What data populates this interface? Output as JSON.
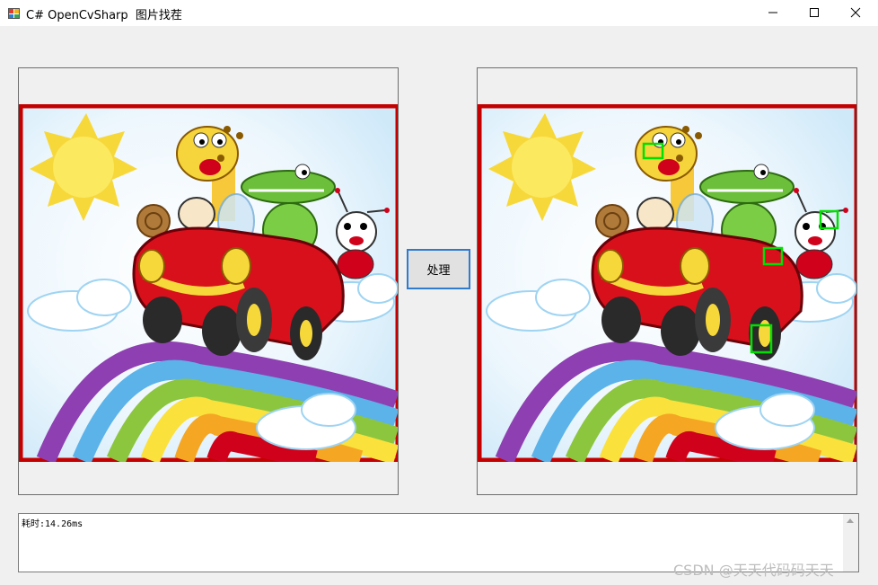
{
  "window": {
    "title": "C# OpenCvSharp  图片找茬",
    "minimize_icon": "minimize-icon",
    "maximize_icon": "maximize-icon",
    "close_icon": "close-icon"
  },
  "controls": {
    "process_button_label": "处理"
  },
  "log": {
    "text": "耗时:14.26ms"
  },
  "watermark": {
    "text": "CSDN @天天代码码天天"
  },
  "colors": {
    "frame_red": "#c40000",
    "diff_box_green": "#00e000",
    "button_border": "#2f7bd0"
  },
  "differences_marked": 4
}
